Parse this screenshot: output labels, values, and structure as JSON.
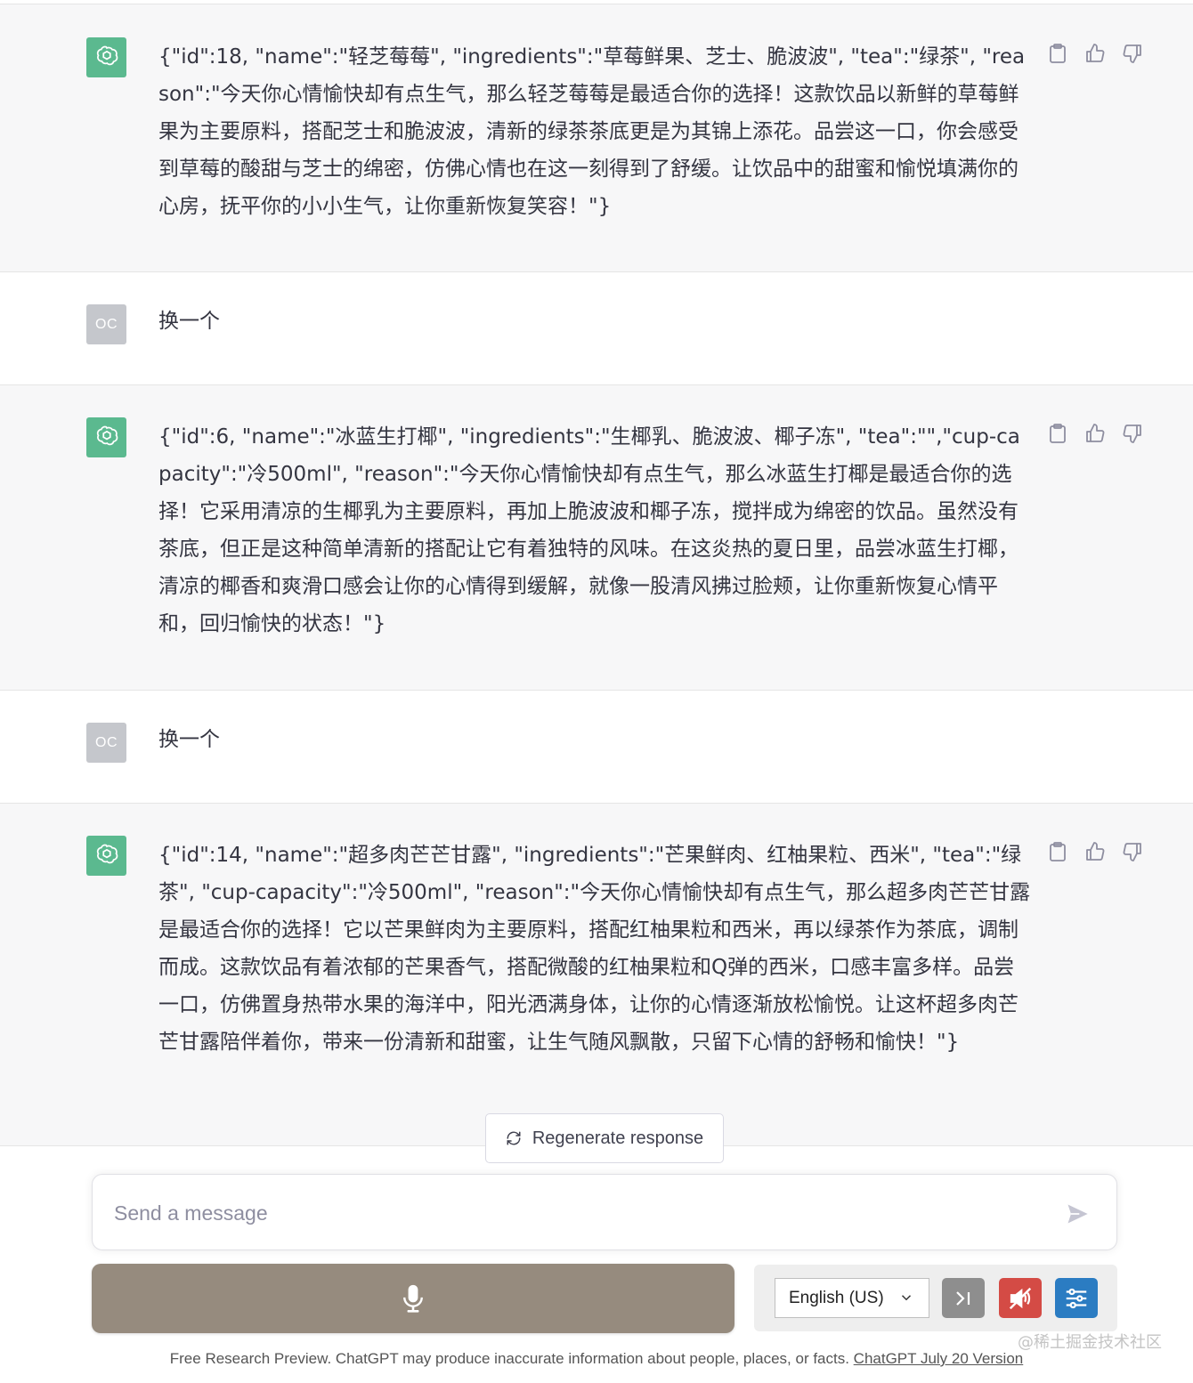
{
  "conversation": [
    {
      "role": "assistant",
      "text": "{\"id\":18, \"name\":\"轻芝莓莓\", \"ingredients\":\"草莓鲜果、芝士、脆波波\", \"tea\":\"绿茶\", \"reason\":\"今天你心情愉快却有点生气，那么轻芝莓莓是最适合你的选择！这款饮品以新鲜的草莓鲜果为主要原料，搭配芝士和脆波波，清新的绿茶茶底更是为其锦上添花。品尝这一口，你会感受到草莓的酸甜与芝士的绵密，仿佛心情也在这一刻得到了舒缓。让饮品中的甜蜜和愉悦填满你的心房，抚平你的小小生气，让你重新恢复笑容！\"}"
    },
    {
      "role": "user",
      "avatar_initials": "OC",
      "text": "换一个"
    },
    {
      "role": "assistant",
      "text": "{\"id\":6, \"name\":\"冰蓝生打椰\", \"ingredients\":\"生椰乳、脆波波、椰子冻\", \"tea\":\"\",\"cup-capacity\":\"冷500ml\", \"reason\":\"今天你心情愉快却有点生气，那么冰蓝生打椰是最适合你的选择！它采用清凉的生椰乳为主要原料，再加上脆波波和椰子冻，搅拌成为绵密的饮品。虽然没有茶底，但正是这种简单清新的搭配让它有着独特的风味。在这炎热的夏日里，品尝冰蓝生打椰，清凉的椰香和爽滑口感会让你的心情得到缓解，就像一股清风拂过脸颊，让你重新恢复心情平和，回归愉快的状态！\"}"
    },
    {
      "role": "user",
      "avatar_initials": "OC",
      "text": "换一个"
    },
    {
      "role": "assistant",
      "text": "{\"id\":14, \"name\":\"超多肉芒芒甘露\", \"ingredients\":\"芒果鲜肉、红柚果粒、西米\", \"tea\":\"绿茶\", \"cup-capacity\":\"冷500ml\", \"reason\":\"今天你心情愉快却有点生气，那么超多肉芒芒甘露是最适合你的选择！它以芒果鲜肉为主要原料，搭配红柚果粒和西米，再以绿茶作为茶底，调制而成。这款饮品有着浓郁的芒果香气，搭配微酸的红柚果粒和Q弹的西米，口感丰富多样。品尝一口，仿佛置身热带水果的海洋中，阳光洒满身体，让你的心情逐渐放松愉悦。让这杯超多肉芒芒甘露陪伴着你，带来一份清新和甜蜜，让生气随风飘散，只留下心情的舒畅和愉快！\"}"
    }
  ],
  "regenerate_label": "Regenerate response",
  "composer": {
    "placeholder": "Send a message"
  },
  "voice_controls": {
    "language": "English (US)"
  },
  "icons": {
    "copy": "clipboard-icon",
    "like": "thumbs-up-icon",
    "dislike": "thumbs-down-icon",
    "send": "send-icon",
    "mic": "microphone-icon",
    "skip": "skip-icon",
    "mute": "speaker-muted-icon",
    "settings": "sliders-icon"
  },
  "colors": {
    "bot_avatar": "#5bb98f",
    "mic_button": "#968b7e",
    "mute_button": "#d44b45",
    "settings_button": "#2b7cc2"
  },
  "watermark": "@稀土掘金技术社区",
  "footer": {
    "text": "Free Research Preview. ChatGPT may produce inaccurate information about people, places, or facts. ",
    "link": "ChatGPT July 20 Version"
  }
}
